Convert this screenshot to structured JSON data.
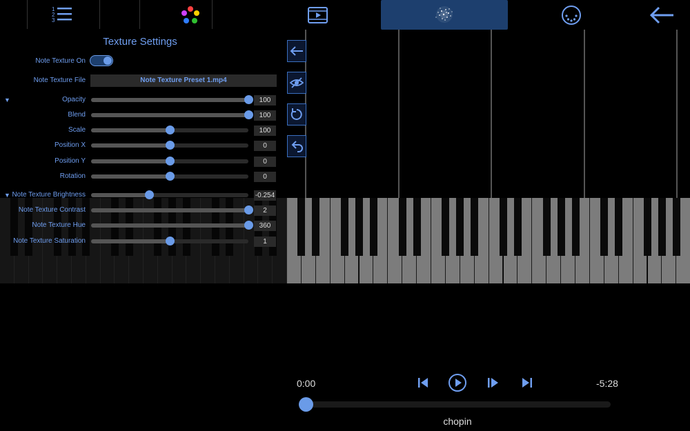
{
  "toolbar": {
    "icons": [
      "numbered-list-icon",
      "color-palette-icon",
      "video-icon",
      "particles-icon",
      "midi-port-icon",
      "back-arrow-icon"
    ]
  },
  "texture_panel": {
    "title": "Texture Settings",
    "note_texture_on_label": "Note Texture On",
    "note_texture_on": true,
    "note_texture_file_label": "Note Texture File",
    "note_texture_file": "Note Texture Preset 1.mp4",
    "sliders": [
      {
        "label": "Opacity",
        "value": "100",
        "fraction": 1.0
      },
      {
        "label": "Blend",
        "value": "100",
        "fraction": 1.0
      },
      {
        "label": "Scale",
        "value": "100",
        "fraction": 0.5
      },
      {
        "label": "Position X",
        "value": "0",
        "fraction": 0.5
      },
      {
        "label": "Position Y",
        "value": "0",
        "fraction": 0.5
      },
      {
        "label": "Rotation",
        "value": "0",
        "fraction": 0.5
      },
      {
        "label": "Note Texture Brightness",
        "value": "-0.254",
        "fraction": 0.37
      },
      {
        "label": "Note Texture Contrast",
        "value": "2",
        "fraction": 1.0
      },
      {
        "label": "Note Texture Hue",
        "value": "360",
        "fraction": 1.0
      },
      {
        "label": "Note Texture Saturation",
        "value": "1",
        "fraction": 0.5
      }
    ]
  },
  "side_buttons": [
    "arrow-left-icon",
    "eye-off-icon",
    "reset-icon",
    "undo-icon"
  ],
  "colors": {
    "accent": "#6a9be8",
    "panel_bg": "#000000",
    "highlight": "#1d3f6e"
  },
  "transport": {
    "elapsed": "0:00",
    "remaining": "-5:28",
    "song_title": "chopin",
    "progress": 0.0
  }
}
